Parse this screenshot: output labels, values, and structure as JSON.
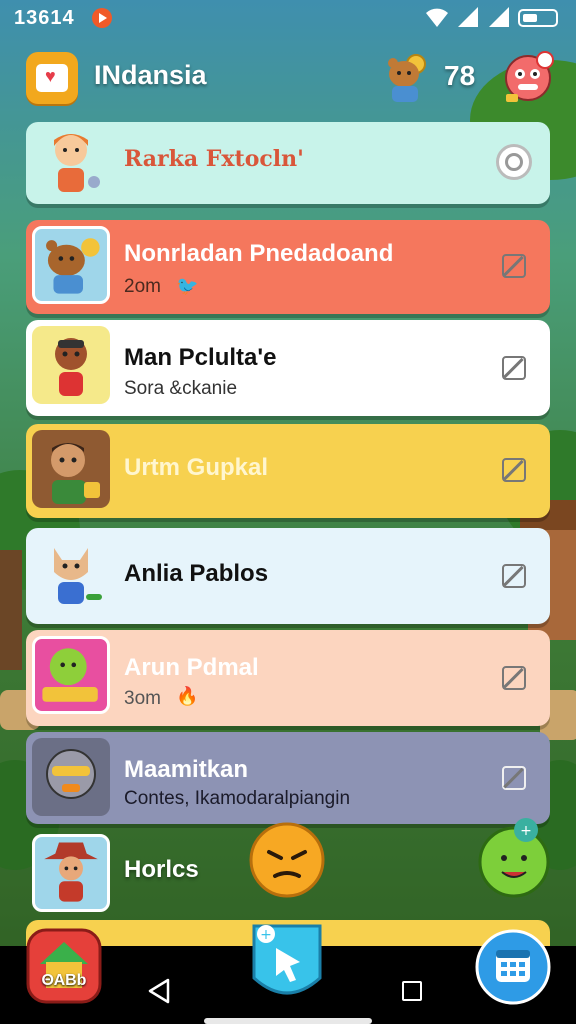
{
  "status_bar": {
    "time": "13614"
  },
  "header": {
    "title": "INdansia",
    "count": "78",
    "logo_icon": "heart-app-icon",
    "mascot_icon": "bear-mascot-icon",
    "avatar_icon": "robot-avatar-icon"
  },
  "cards": [
    {
      "title": "Rarka Fxtocln'",
      "subtitle": "",
      "bg": "#c8f3ea",
      "title_color": "#d9563a",
      "control": "radio"
    },
    {
      "title": "Nonrladan Pnedadoand",
      "subtitle": "2om",
      "bg": "#f5775d",
      "title_color": "#ffffff",
      "sub_color": "#4b2a1f",
      "control": "checkbox"
    },
    {
      "title": "Man Pclulta'e",
      "subtitle": "Sora &ckanie",
      "bg": "#ffffff",
      "title_color": "#111111",
      "sub_color": "#333333",
      "control": "checkbox"
    },
    {
      "title": "Urtm Gupkal",
      "subtitle": "",
      "bg": "#f7d14f",
      "title_color": "#fff6cf",
      "control": "checkbox"
    },
    {
      "title": "Anlia Pablos",
      "subtitle": "",
      "bg": "#e6f4fb",
      "title_color": "#111111",
      "control": "checkbox"
    },
    {
      "title": "Arun Pdmal",
      "subtitle": "3om",
      "bg": "#fcd5bf",
      "title_color": "#ffffff",
      "sub_color": "#555555",
      "control": "checkbox"
    },
    {
      "title": "Maamitkan",
      "subtitle": "Contes, Ikamodaralpiangin",
      "bg": "#8d93b4",
      "title_color": "#ffffff",
      "sub_color": "#1b1b2a",
      "control": "checkbox"
    },
    {
      "title": "Horlcs",
      "subtitle": "",
      "bg": "transparent",
      "title_color": "#ffffff",
      "control": "none"
    }
  ],
  "bottom_buttons": {
    "home_label": "ΘΑΒb",
    "home_icon": "house-icon",
    "main_icon": "hand-pointer-icon",
    "calendar_icon": "calendar-icon"
  },
  "floating": {
    "angry_icon": "angry-face-icon",
    "green_icon": "green-smiley-icon"
  }
}
